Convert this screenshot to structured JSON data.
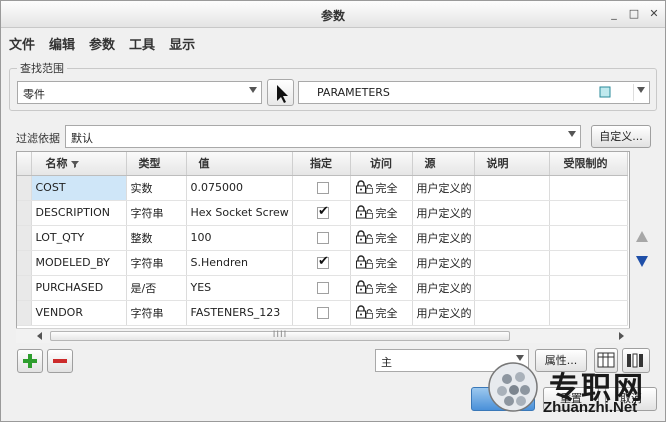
{
  "window": {
    "title": "参数",
    "controls": {
      "minimize": "_",
      "maximize": "□",
      "close": "✕"
    }
  },
  "menu": [
    "文件",
    "编辑",
    "参数",
    "工具",
    "显示"
  ],
  "scope": {
    "legend": "查找范围",
    "object_type": "零件",
    "object_name": "PARAMETERS"
  },
  "filter": {
    "label": "过滤依据",
    "value": "默认",
    "customize_label": "自定义..."
  },
  "table": {
    "columns": [
      "名称",
      "类型",
      "值",
      "指定",
      "访问",
      "源",
      "说明",
      "受限制的"
    ],
    "rows": [
      {
        "name": "COST",
        "type": "实数",
        "value": "0.075000",
        "designated": false,
        "access": "完全",
        "source": "用户定义的",
        "description": "",
        "restricted": ""
      },
      {
        "name": "DESCRIPTION",
        "type": "字符串",
        "value": "Hex Socket Screw",
        "designated": true,
        "access": "完全",
        "source": "用户定义的",
        "description": "",
        "restricted": ""
      },
      {
        "name": "LOT_QTY",
        "type": "整数",
        "value": "100",
        "designated": false,
        "access": "完全",
        "source": "用户定义的",
        "description": "",
        "restricted": ""
      },
      {
        "name": "MODELED_BY",
        "type": "字符串",
        "value": "S.Hendren",
        "designated": true,
        "access": "完全",
        "source": "用户定义的",
        "description": "",
        "restricted": ""
      },
      {
        "name": "PURCHASED",
        "type": "是/否",
        "value": "YES",
        "designated": false,
        "access": "完全",
        "source": "用户定义的",
        "description": "",
        "restricted": ""
      },
      {
        "name": "VENDOR",
        "type": "字符串",
        "value": "FASTENERS_123",
        "designated": false,
        "access": "完全",
        "source": "用户定义的",
        "description": "",
        "restricted": ""
      }
    ],
    "scroll_grip": "IIII"
  },
  "bottom": {
    "add": "+",
    "remove": "−",
    "view_value": "主",
    "properties_label": "属性...",
    "reset_label": "重置",
    "cancel_label": "取消"
  },
  "watermark": {
    "text_cn": "专职网",
    "text_url": "Zhuanzhi.Net"
  },
  "colors": {
    "selection": "#cfe6f8",
    "add_green": "#2e9e2e",
    "remove_red": "#cc2a2a",
    "down_arrow_blue": "#1f4fa8",
    "ok_blue": "#4a90d9"
  }
}
